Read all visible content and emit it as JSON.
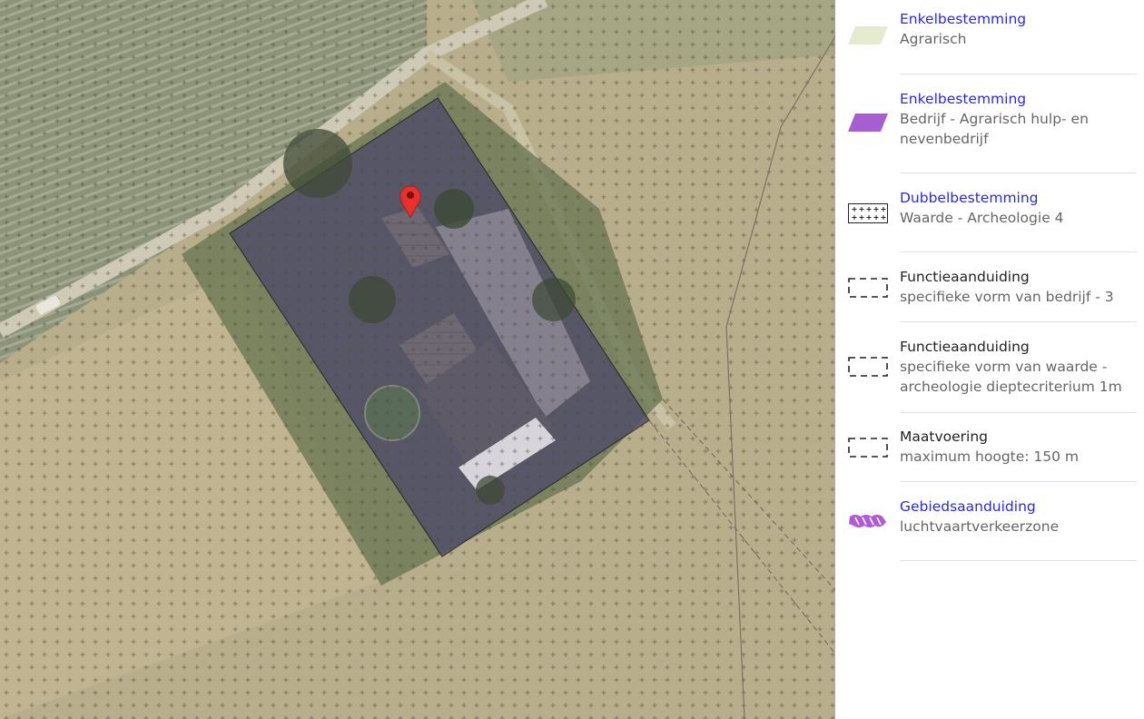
{
  "map": {
    "marker_icon": "map-pin-icon",
    "colors": {
      "agrarisch": "#e4ecd0",
      "bedrijf": "#a65fd1",
      "marker": "#e8312a",
      "parcel_outline": "#1c1c1c"
    }
  },
  "legend": {
    "items": [
      {
        "title": "Enkelbestemming",
        "subtitle": "Agrarisch",
        "icon": "agrarisch-swatch-icon"
      },
      {
        "title": "Enkelbestemming",
        "subtitle": "Bedrijf - Agrarisch hulp- en nevenbedrijf",
        "icon": "bedrijf-swatch-icon"
      },
      {
        "title": "Dubbelbestemming",
        "subtitle": "Waarde - Archeologie 4",
        "icon": "archeologie-swatch-icon"
      },
      {
        "title": "Functieaanduiding",
        "subtitle": "specifieke vorm van bedrijf - 3",
        "icon": "dashed-box-icon"
      },
      {
        "title": "Functieaanduiding",
        "subtitle": "specifieke vorm van waarde - archeologie dieptecriterium 1m",
        "icon": "dashed-box-icon"
      },
      {
        "title": "Maatvoering",
        "subtitle": "maximum hoogte: 150 m",
        "icon": "dashed-box-icon"
      },
      {
        "title": "Gebiedsaanduiding",
        "subtitle": "luchtvaartverkeerzone",
        "icon": "luchtvaart-swatch-icon"
      }
    ]
  }
}
